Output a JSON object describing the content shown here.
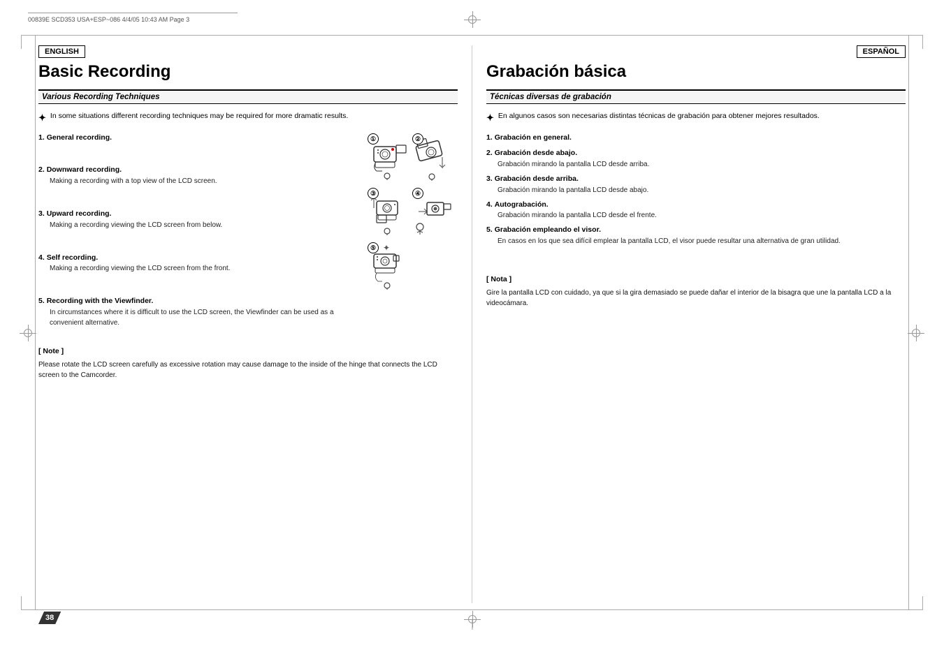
{
  "header": {
    "ref": "00839E SCD353 USA+ESP~086   4/4/05  10:43 AM   Page 3"
  },
  "left": {
    "lang_badge": "ENGLISH",
    "title": "Basic Recording",
    "subtitle": "Various Recording Techniques",
    "intro_bullet": "In some situations different recording techniques may be required for more dramatic results.",
    "items": [
      {
        "num": "1.",
        "title": "General recording.",
        "desc": ""
      },
      {
        "num": "2.",
        "title": "Downward recording.",
        "desc": "Making a recording with a top view of the LCD screen."
      },
      {
        "num": "3.",
        "title": "Upward recording.",
        "desc": "Making a recording viewing the LCD screen from below."
      },
      {
        "num": "4.",
        "title": "Self recording.",
        "desc": "Making a recording viewing the LCD screen from the front."
      },
      {
        "num": "5.",
        "title": "Recording with the Viewfinder.",
        "desc": "In circumstances where it is difficult to use the LCD screen, the Viewfinder can be used as a convenient alternative."
      }
    ],
    "note_title": "[ Note ]",
    "note_text": "Please rotate the LCD screen carefully as excessive rotation may cause damage to the inside of the hinge that connects the LCD screen to the Camcorder."
  },
  "right": {
    "lang_badge": "ESPAÑOL",
    "title": "Grabación básica",
    "subtitle": "Técnicas diversas de grabación",
    "intro_bullet": "En algunos casos son necesarias distintas técnicas de grabación para obtener mejores resultados.",
    "items": [
      {
        "num": "1.",
        "title": "Grabación en general.",
        "desc": ""
      },
      {
        "num": "2.",
        "title": "Grabación desde abajo.",
        "desc": "Grabación mirando la pantalla LCD desde arriba."
      },
      {
        "num": "3.",
        "title": "Grabación desde arriba.",
        "desc": "Grabación mirando la pantalla LCD desde abajo."
      },
      {
        "num": "4.",
        "title": "Autograbación.",
        "desc": "Grabación mirando la pantalla LCD desde el frente."
      },
      {
        "num": "5.",
        "title": "Grabación empleando el visor.",
        "desc": "En casos en los que sea difícil emplear la pantalla LCD, el visor puede resultar una alternativa de gran utilidad."
      }
    ],
    "note_title": "[ Nota ]",
    "note_text": "Gire la pantalla LCD con cuidado, ya que si la gira demasiado se puede dañar el interior de la bisagra que une la pantalla LCD a la videocámara."
  },
  "page_num": "38",
  "images": {
    "labels": [
      "①",
      "②",
      "③",
      "④",
      "⑤"
    ]
  }
}
